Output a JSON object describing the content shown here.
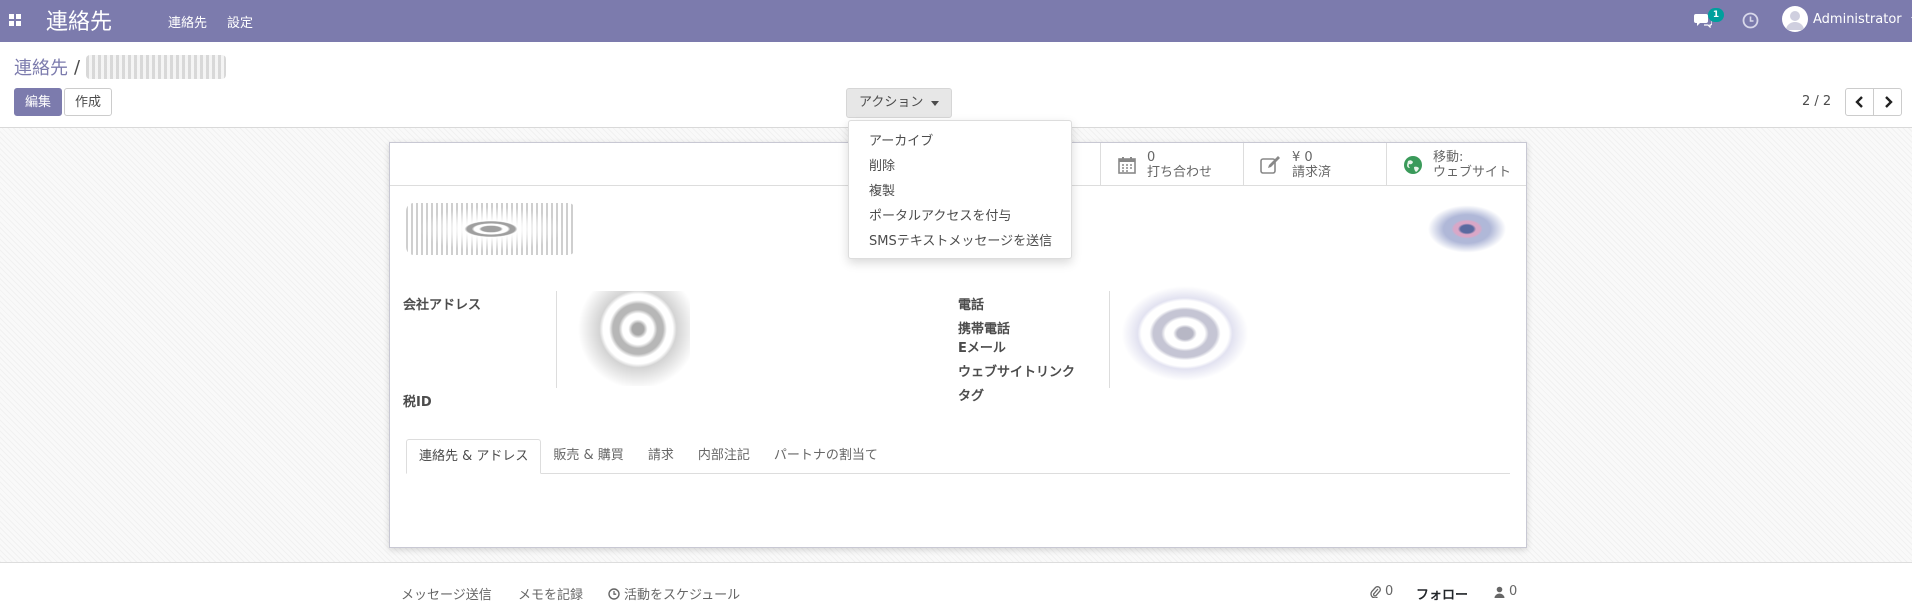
{
  "navbar": {
    "brand": "連絡先",
    "menu": [
      "連絡先",
      "設定"
    ],
    "chat_badge": "1",
    "user": "Administrator",
    "bg_color": "#7c7bad"
  },
  "breadcrumb": {
    "root": "連絡先",
    "separator": "/"
  },
  "toolbar": {
    "edit": "編集",
    "create": "作成",
    "action": "アクション",
    "pager_value": "2 / 2"
  },
  "action_menu": [
    "アーカイブ",
    "削除",
    "複製",
    "ポータルアクセスを付与",
    "SMSテキストメッセージを送信"
  ],
  "stat_buttons": [
    {
      "value": "0",
      "label": "打ち合わせ",
      "icon": "calendar-icon"
    },
    {
      "value": "¥ 0",
      "label": "請求済",
      "icon": "edit-icon"
    },
    {
      "value": "移動:",
      "label": "ウェブサイト",
      "icon": "globe-icon"
    }
  ],
  "fields": {
    "company_address": "会社アドレス",
    "tax_id": "税ID",
    "phone": "電話",
    "mobile": "携帯電話",
    "email": "Eメール",
    "website": "ウェブサイトリンク",
    "tags": "タグ"
  },
  "tabs": [
    "連絡先 & アドレス",
    "販売 & 購買",
    "請求",
    "内部注記",
    "パートナの割当て"
  ],
  "chatter": {
    "send_message": "メッセージ送信",
    "log_note": "メモを記録",
    "schedule": "活動をスケジュール",
    "attachments": "0",
    "follow": "フォロー",
    "followers": "0"
  }
}
